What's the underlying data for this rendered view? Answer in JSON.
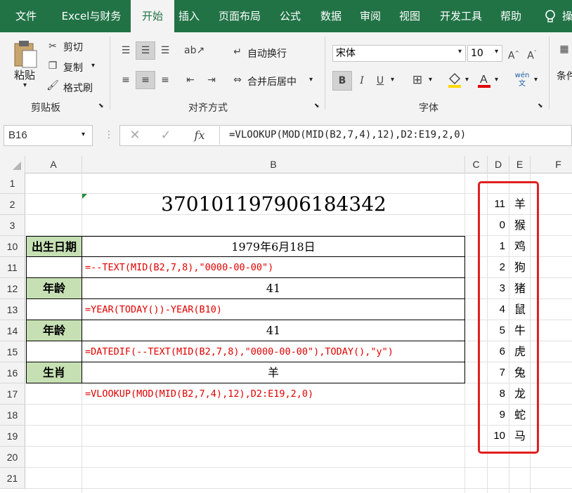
{
  "ribbon": {
    "tabs": [
      "文件",
      "Excel与财务",
      "开始",
      "插入",
      "页面布局",
      "公式",
      "数据",
      "审阅",
      "视图",
      "开发工具",
      "帮助",
      "操"
    ],
    "active_tab": "开始",
    "clipboard": {
      "paste": "粘贴",
      "cut": "剪切",
      "copy": "复制",
      "format_painter": "格式刷",
      "group": "剪贴板"
    },
    "alignment": {
      "wrap_text": "自动换行",
      "merge_center": "合并后居中",
      "group": "对齐方式"
    },
    "font": {
      "name": "宋体",
      "size": "10",
      "bold": "B",
      "italic": "I",
      "underline": "U",
      "phonetic": "wén 文",
      "group": "字体",
      "font_color": "#e00000"
    },
    "conditional": "条件"
  },
  "formula_bar": {
    "name_box": "B16",
    "fx": "fx",
    "formula": "=VLOOKUP(MOD(MID(B2,7,4),12),D2:E19,2,0)"
  },
  "columns": [
    "A",
    "B",
    "C",
    "D",
    "E",
    "F"
  ],
  "rows": [
    "1",
    "2",
    "3",
    "10",
    "11",
    "12",
    "13",
    "14",
    "15",
    "16",
    "17",
    "18",
    "19",
    "20",
    "21"
  ],
  "sheet": {
    "b2": "370101197906184342",
    "a10": "出生日期",
    "b10": "1979年6月18日",
    "b11": "=--TEXT(MID(B2,7,8),\"0000-00-00\")",
    "a12": "年龄",
    "b12": "41",
    "b13": "=YEAR(TODAY())-YEAR(B10)",
    "a14": "年龄",
    "b14": "41",
    "b15": "=DATEDIF(--TEXT(MID(B2,7,8),\"0000-00-00\"),TODAY(),\"y\")",
    "a16": "生肖",
    "b16": "羊",
    "b17": "=VLOOKUP(MOD(MID(B2,7,4),12),D2:E19,2,0)"
  },
  "zodiac_table": [
    {
      "num": "11",
      "animal": "羊"
    },
    {
      "num": "0",
      "animal": "猴"
    },
    {
      "num": "1",
      "animal": "鸡"
    },
    {
      "num": "2",
      "animal": "狗"
    },
    {
      "num": "3",
      "animal": "猪"
    },
    {
      "num": "4",
      "animal": "鼠"
    },
    {
      "num": "5",
      "animal": "牛"
    },
    {
      "num": "6",
      "animal": "虎"
    },
    {
      "num": "7",
      "animal": "兔"
    },
    {
      "num": "8",
      "animal": "龙"
    },
    {
      "num": "9",
      "animal": "蛇"
    },
    {
      "num": "10",
      "animal": "马"
    }
  ],
  "colors": {
    "excel_green": "#217346",
    "label_fill": "#c6e0b4",
    "formula_red": "#e00000",
    "highlight_box": "#e0201e"
  }
}
